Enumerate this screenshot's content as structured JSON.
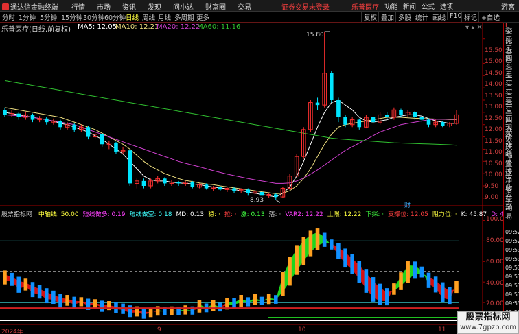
{
  "topbar": {
    "app_name": "通达信金融终端",
    "nav": [
      "行情",
      "市场",
      "资讯",
      "发现",
      "问小达",
      "财富圈",
      "交易"
    ],
    "warning": "证券交易未登录",
    "stock_name": "乐普医疗",
    "right": [
      "功能",
      "新闻",
      "公式",
      "选项"
    ],
    "guest": "游客"
  },
  "periods": [
    "分时",
    "1分钟",
    "5分钟",
    "15分钟",
    "30分钟",
    "60分钟",
    "日线",
    "周线",
    "月线",
    "多周期",
    "更多"
  ],
  "active_period": "日线",
  "tools": [
    "复权",
    "叠加",
    "多股",
    "统计",
    "画线",
    "F10",
    "标记",
    "+自选"
  ],
  "main_chart": {
    "title": "乐普医疗(日线,前复权)",
    "ma5_label": "MA5: 12.05",
    "ma10_label": "MA10: 12.21",
    "ma20_label": "MA20: 12.22",
    "ma60_label": "MA60: 11.16",
    "high_annot": "15.80",
    "low_annot": "8.93",
    "y_ticks": [
      "15.50",
      "15.00",
      "14.50",
      "14.00",
      "13.50",
      "13.00",
      "12.50",
      "12.00",
      "11.50",
      "11.00",
      "10.50",
      "10.00",
      "9.50",
      "9.00"
    ],
    "event_marker": "财",
    "colors": {
      "up": "#ff3030",
      "down": "#00e5ff",
      "ma5": "#ffffff",
      "ma10": "#f0e080",
      "ma20": "#d040d0",
      "ma60": "#30c030"
    }
  },
  "chart_data": {
    "type": "candlestick",
    "ylim": [
      8.8,
      15.8
    ],
    "series": [
      {
        "name": "K",
        "values": [
          [
            12.6,
            12.4,
            12.7,
            12.3
          ],
          [
            12.4,
            12.45,
            12.6,
            12.3
          ],
          [
            12.45,
            12.3,
            12.5,
            12.2
          ],
          [
            12.3,
            12.4,
            12.5,
            12.2
          ],
          [
            12.4,
            12.2,
            12.45,
            12.1
          ],
          [
            12.2,
            12.25,
            12.35,
            12.1
          ],
          [
            12.25,
            12.1,
            12.3,
            12.0
          ],
          [
            12.1,
            12.15,
            12.25,
            12.0
          ],
          [
            12.15,
            11.9,
            12.2,
            11.8
          ],
          [
            11.9,
            12.0,
            12.1,
            11.8
          ],
          [
            12.0,
            11.8,
            12.05,
            11.7
          ],
          [
            11.8,
            11.9,
            12.0,
            11.7
          ],
          [
            11.9,
            11.5,
            11.95,
            11.4
          ],
          [
            11.5,
            11.6,
            11.7,
            11.4
          ],
          [
            11.6,
            11.2,
            11.65,
            11.1
          ],
          [
            11.2,
            11.25,
            11.35,
            11.0
          ],
          [
            11.25,
            10.9,
            11.3,
            10.8
          ],
          [
            10.9,
            10.95,
            11.1,
            10.8
          ],
          [
            10.95,
            9.6,
            11.0,
            9.5
          ],
          [
            9.6,
            9.7,
            9.8,
            9.4
          ],
          [
            9.7,
            9.5,
            9.8,
            9.4
          ],
          [
            9.5,
            9.7,
            9.8,
            9.4
          ],
          [
            9.7,
            9.8,
            9.9,
            9.6
          ],
          [
            9.8,
            9.6,
            9.85,
            9.5
          ],
          [
            9.6,
            9.65,
            9.75,
            9.5
          ],
          [
            9.65,
            9.6,
            9.7,
            9.5
          ],
          [
            9.6,
            9.65,
            9.7,
            9.5
          ],
          [
            9.65,
            9.45,
            9.7,
            9.4
          ],
          [
            9.45,
            9.55,
            9.6,
            9.4
          ],
          [
            9.55,
            9.4,
            9.6,
            9.35
          ],
          [
            9.4,
            9.45,
            9.5,
            9.3
          ],
          [
            9.45,
            9.35,
            9.5,
            9.3
          ],
          [
            9.35,
            9.4,
            9.45,
            9.25
          ],
          [
            9.4,
            9.3,
            9.45,
            9.2
          ],
          [
            9.3,
            9.35,
            9.4,
            9.2
          ],
          [
            9.35,
            9.2,
            9.4,
            9.1
          ],
          [
            9.2,
            9.25,
            9.3,
            9.1
          ],
          [
            9.25,
            9.1,
            9.3,
            9.0
          ],
          [
            9.1,
            9.15,
            9.2,
            9.0
          ],
          [
            9.15,
            9.05,
            9.2,
            8.93
          ],
          [
            9.05,
            9.4,
            9.45,
            9.0
          ],
          [
            9.4,
            9.9,
            10.0,
            9.35
          ],
          [
            9.9,
            10.7,
            10.8,
            9.85
          ],
          [
            10.7,
            11.8,
            11.9,
            10.6
          ],
          [
            11.8,
            12.9,
            13.0,
            11.7
          ],
          [
            12.9,
            12.8,
            13.1,
            12.6
          ],
          [
            12.8,
            14.1,
            15.8,
            12.7
          ],
          [
            14.1,
            13.0,
            14.2,
            12.9
          ],
          [
            13.0,
            12.3,
            13.1,
            12.1
          ],
          [
            12.3,
            12.0,
            12.4,
            11.9
          ],
          [
            12.0,
            12.2,
            12.3,
            11.9
          ],
          [
            12.2,
            11.9,
            12.25,
            11.8
          ],
          [
            11.9,
            12.3,
            12.4,
            11.85
          ],
          [
            12.3,
            12.1,
            12.35,
            12.0
          ],
          [
            12.1,
            12.4,
            12.5,
            12.0
          ],
          [
            12.4,
            12.3,
            12.5,
            12.2
          ],
          [
            12.3,
            12.6,
            12.7,
            12.2
          ],
          [
            12.6,
            12.4,
            12.65,
            12.3
          ],
          [
            12.4,
            12.5,
            12.6,
            12.3
          ],
          [
            12.5,
            12.3,
            12.55,
            12.2
          ],
          [
            12.3,
            12.2,
            12.4,
            12.1
          ],
          [
            12.2,
            12.0,
            12.25,
            11.9
          ],
          [
            12.0,
            12.1,
            12.2,
            11.9
          ],
          [
            12.1,
            11.95,
            12.15,
            11.9
          ],
          [
            11.95,
            12.05,
            12.1,
            11.9
          ],
          [
            12.05,
            12.4,
            12.6,
            12.0
          ]
        ]
      },
      {
        "name": "MA5",
        "values": [
          12.5,
          12.45,
          12.4,
          12.35,
          12.3,
          12.25,
          12.2,
          12.15,
          12.05,
          12.0,
          11.9,
          11.8,
          11.7,
          11.55,
          11.4,
          11.2,
          11.0,
          10.8,
          10.5,
          10.2,
          9.9,
          9.75,
          9.7,
          9.7,
          9.65,
          9.62,
          9.6,
          9.58,
          9.55,
          9.5,
          9.45,
          9.42,
          9.38,
          9.35,
          9.3,
          9.25,
          9.2,
          9.15,
          9.1,
          9.05,
          9.2,
          9.45,
          9.9,
          10.5,
          11.2,
          11.9,
          12.5,
          12.9,
          13.0,
          12.8,
          12.6,
          12.3,
          12.15,
          12.1,
          12.15,
          12.2,
          12.3,
          12.35,
          12.4,
          12.4,
          12.35,
          12.25,
          12.15,
          12.1,
          12.05,
          12.05
        ]
      },
      {
        "name": "MA10",
        "values": [
          12.7,
          12.65,
          12.6,
          12.55,
          12.5,
          12.45,
          12.4,
          12.35,
          12.3,
          12.2,
          12.1,
          12.0,
          11.9,
          11.8,
          11.65,
          11.5,
          11.35,
          11.2,
          11.0,
          10.75,
          10.5,
          10.3,
          10.15,
          10.0,
          9.9,
          9.8,
          9.72,
          9.68,
          9.62,
          9.58,
          9.55,
          9.5,
          9.46,
          9.42,
          9.38,
          9.34,
          9.3,
          9.26,
          9.22,
          9.18,
          9.2,
          9.3,
          9.5,
          9.8,
          10.2,
          10.7,
          11.2,
          11.6,
          11.9,
          12.0,
          12.05,
          12.1,
          12.15,
          12.2,
          12.25,
          12.3,
          12.3,
          12.3,
          12.28,
          12.26,
          12.25,
          12.24,
          12.23,
          12.22,
          12.21,
          12.21
        ]
      },
      {
        "name": "MA20",
        "values": [
          12.4,
          12.38,
          12.36,
          12.34,
          12.3,
          12.25,
          12.2,
          12.15,
          12.1,
          12.05,
          12.0,
          11.9,
          11.8,
          11.7,
          11.6,
          11.5,
          11.4,
          11.3,
          11.2,
          11.1,
          11.0,
          10.9,
          10.8,
          10.7,
          10.6,
          10.5,
          10.42,
          10.35,
          10.28,
          10.2,
          10.12,
          10.05,
          9.98,
          9.92,
          9.86,
          9.8,
          9.75,
          9.7,
          9.65,
          9.6,
          9.6,
          9.62,
          9.7,
          9.82,
          9.98,
          10.15,
          10.35,
          10.55,
          10.75,
          10.95,
          11.1,
          11.25,
          11.4,
          11.55,
          11.7,
          11.8,
          11.9,
          12.0,
          12.05,
          12.1,
          12.15,
          12.2,
          12.22,
          12.22,
          12.22,
          12.22
        ]
      },
      {
        "name": "MA60",
        "values": [
          13.8,
          13.75,
          13.7,
          13.65,
          13.6,
          13.55,
          13.5,
          13.45,
          13.4,
          13.35,
          13.3,
          13.25,
          13.2,
          13.15,
          13.1,
          13.05,
          13.0,
          12.95,
          12.9,
          12.85,
          12.8,
          12.75,
          12.7,
          12.65,
          12.6,
          12.55,
          12.5,
          12.45,
          12.4,
          12.35,
          12.3,
          12.25,
          12.2,
          12.15,
          12.1,
          12.05,
          12.0,
          11.95,
          11.9,
          11.85,
          11.8,
          11.75,
          11.7,
          11.65,
          11.6,
          11.55,
          11.5,
          11.45,
          11.42,
          11.4,
          11.38,
          11.36,
          11.34,
          11.32,
          11.3,
          11.28,
          11.26,
          11.25,
          11.24,
          11.23,
          11.22,
          11.21,
          11.2,
          11.19,
          11.18,
          11.16
        ]
      }
    ]
  },
  "indicator": {
    "title": "股票指标网",
    "labels": [
      {
        "text": "中轴线: 50.00",
        "color": "#ffff40"
      },
      {
        "text": "短线做多: 0.19",
        "color": "#ff40ff"
      },
      {
        "text": "短线做空: 0.18",
        "color": "#40ffff"
      },
      {
        "text": "MD: 0.13",
        "color": "#ffffff"
      },
      {
        "text": "稳: ·",
        "color": "#ffff40"
      },
      {
        "text": "拉: ·",
        "color": "#ff4040"
      },
      {
        "text": "涨: 0.13",
        "color": "#40ff40"
      },
      {
        "text": "落: ·",
        "color": "#c8c8c8"
      },
      {
        "text": "VAR2: 12.22",
        "color": "#ff40ff"
      },
      {
        "text": "上限: 12.22",
        "color": "#ffff40"
      },
      {
        "text": "下探: ·",
        "color": "#40ff40"
      },
      {
        "text": "支撑位: 12.05",
        "color": "#ff4040"
      },
      {
        "text": "阻力位: ·",
        "color": "#ffff40"
      },
      {
        "text": "K: 45.87",
        "color": "#ffffff"
      },
      {
        "text": "D: 40.18",
        "color": "#ff40ff"
      }
    ],
    "y_ticks": [
      "100.00",
      "80.00",
      "60.00",
      "40.00",
      "20.00"
    ],
    "ylim": [
      0,
      105
    ],
    "line_80": 80,
    "line_50": 50,
    "line_20": 20
  },
  "x_axis": {
    "labels": [
      "2024年",
      "9",
      "10",
      "11"
    ]
  },
  "right_panel": {
    "top": "L",
    "labels": [
      "委比",
      "卖五",
      "卖四",
      "卖三",
      "卖二",
      "卖一",
      "买一",
      "买二",
      "买三",
      "买四",
      "买五",
      "现价",
      "涨跌",
      "涨幅",
      "总量",
      "外盘",
      "换手",
      "净资",
      "收益",
      "自动",
      "交易"
    ],
    "times": [
      "09:52",
      "09:52",
      "09:53",
      "09:53",
      "09:53",
      "09:53",
      "09:53",
      "09:53",
      "09:53",
      "09:53"
    ]
  },
  "watermark": {
    "line1": "股票指标网",
    "line2": "www.7gpzb.com"
  }
}
